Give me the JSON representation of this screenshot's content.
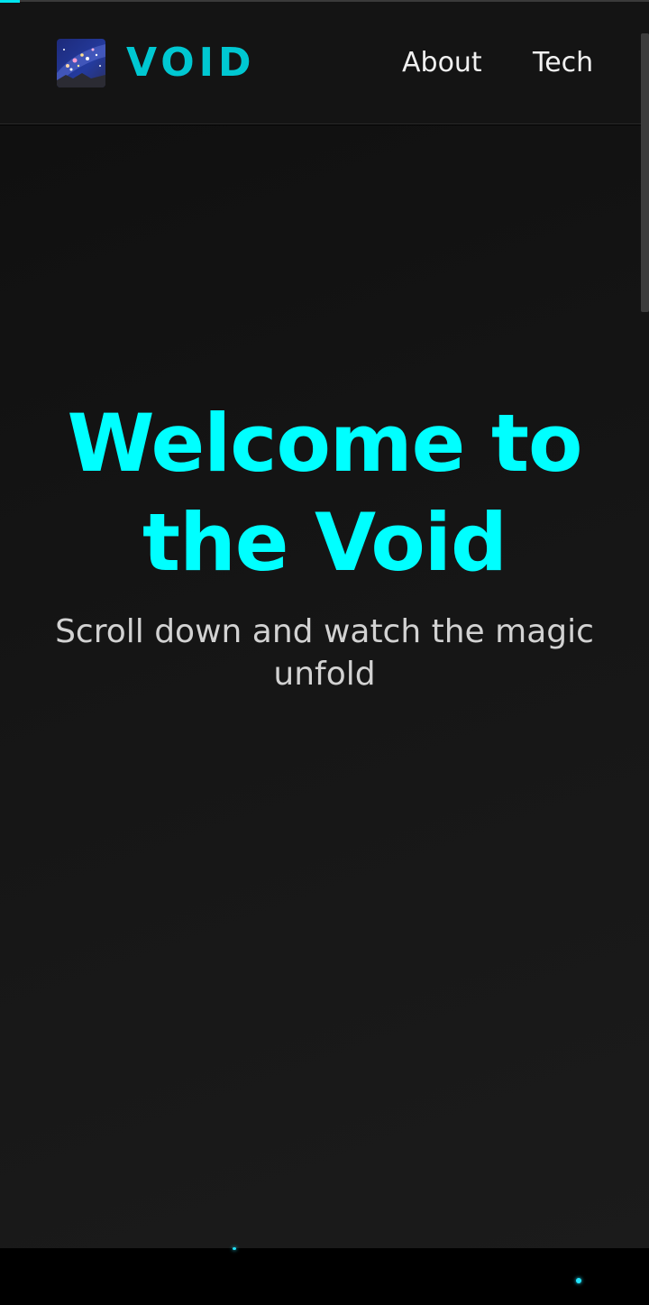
{
  "header": {
    "brand": "VOID",
    "logo": "galaxy-logo-image",
    "nav": [
      {
        "label": "About"
      },
      {
        "label": "Tech"
      }
    ]
  },
  "hero": {
    "title": "Welcome to the Void",
    "subtitle": "Scroll down and watch the magic unfold"
  },
  "scroll_progress": 0.03,
  "colors": {
    "accent": "#00ffff",
    "brand": "#00c8d2",
    "background": "#141414",
    "subtitle": "#d2d2d2"
  }
}
